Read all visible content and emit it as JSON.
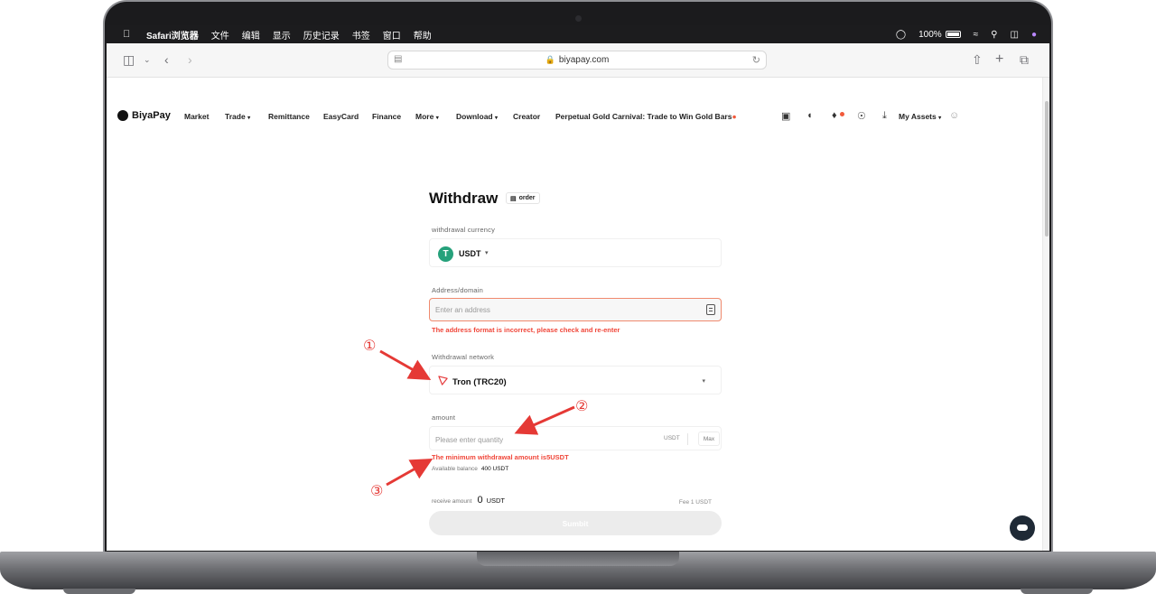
{
  "menubar": {
    "app": "Safari浏览器",
    "items": [
      "文件",
      "编辑",
      "显示",
      "历史记录",
      "书签",
      "窗口",
      "帮助"
    ],
    "battery": "100%"
  },
  "browser": {
    "url": "biyapay.com"
  },
  "site_nav": {
    "brand": "BiyaPay",
    "links": [
      "Market",
      "Trade",
      "Remittance",
      "EasyCard",
      "Finance",
      "More",
      "Download",
      "Creator"
    ],
    "promo": "Perpetual Gold Carnival: Trade to Win Gold Bars",
    "assets": "My Assets"
  },
  "form": {
    "title": "Withdraw",
    "order_label": "order",
    "currency_label": "withdrawal currency",
    "currency_value": "USDT",
    "address_label": "Address/domain",
    "address_placeholder": "Enter an address",
    "address_error": "The address format is incorrect, please check and re-enter",
    "network_label": "Withdrawal network",
    "network_value": "Tron (TRC20)",
    "amount_label": "amount",
    "amount_placeholder": "Please enter quantity",
    "amount_unit": "USDT",
    "max_label": "Max",
    "amount_error": "The minimum withdrawal amount is5USDT",
    "balance_label": "Available balance",
    "balance_value": "400 USDT",
    "receive_label": "receive amount",
    "receive_value": "0",
    "receive_unit": "USDT",
    "fee": "Fee 1 USDT",
    "submit_label": "Sumbit"
  },
  "annotations": [
    "①",
    "②",
    "③"
  ],
  "colors": {
    "error": "#f0473a",
    "accent_usdt": "#26a17b",
    "arrow": "#e53935"
  }
}
